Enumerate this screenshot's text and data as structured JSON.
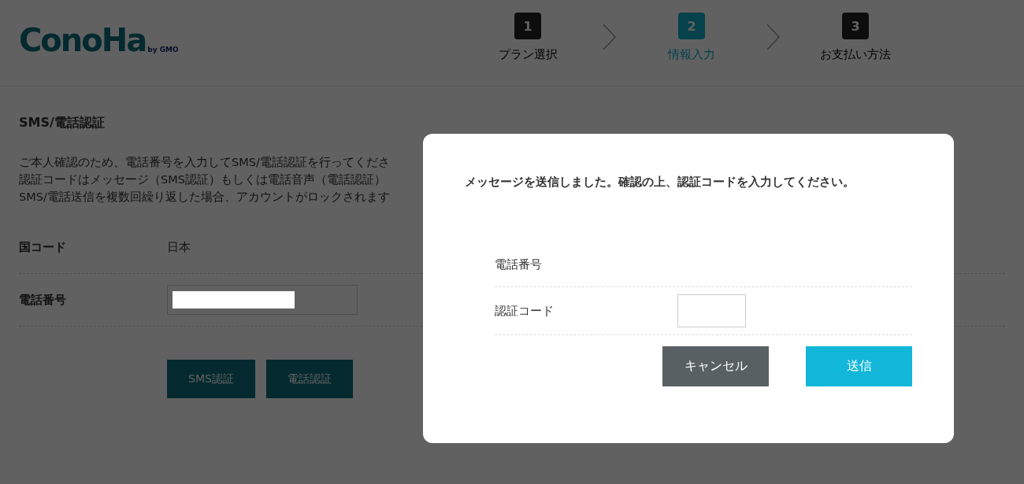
{
  "logo": {
    "name": "ConoHa",
    "byline": "by GMO"
  },
  "steps": [
    {
      "number": "1",
      "label": "プラン選択",
      "selected": false
    },
    {
      "number": "2",
      "label": "情報入力",
      "selected": true
    },
    {
      "number": "3",
      "label": "お支払い方法",
      "selected": false
    }
  ],
  "section": {
    "title": "SMS/電話認証",
    "description": [
      "ご本人確認のため、電話番号を入力してSMS/電話認証を行ってくださ",
      "認証コードはメッセージ（SMS認証）もしくは電話音声（電話認証）",
      "SMS/電話送信を複数回繰り返した場合、アカウントがロックされます"
    ],
    "fields": [
      {
        "kind": "text",
        "label": "国コード",
        "value": "日本"
      },
      {
        "kind": "input",
        "label": "電話番号"
      }
    ],
    "buttons": [
      "SMS認証",
      "電話認証"
    ]
  },
  "dialog": {
    "message": "メッセージを送信しました。確認の上、認証コードを入力してください。",
    "fields": [
      {
        "kind": "text",
        "label": "電話番号"
      },
      {
        "kind": "input",
        "label": "認証コード"
      }
    ],
    "buttons": [
      {
        "kind": "secondary",
        "label": "キャンセル"
      },
      {
        "kind": "primary",
        "label": "送信"
      }
    ]
  }
}
